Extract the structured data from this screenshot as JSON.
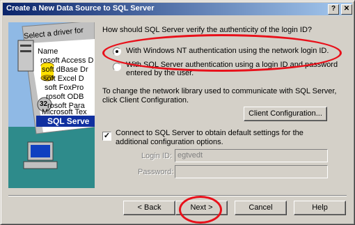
{
  "window": {
    "title": "Create a New Data Source to SQL Server",
    "help_glyph": "?",
    "close_glyph": "✕"
  },
  "art": {
    "header": "Select a driver for",
    "items": [
      "Name",
      "rosoft Access D",
      "soft dBase Dr",
      "soft Excel D",
      "soft FoxPro",
      "rosoft ODB",
      "rosoft Para",
      "Microsoft Tex",
      "SQL Serve"
    ],
    "badge": "32"
  },
  "auth": {
    "question": "How should SQL Server verify the authenticity of the login ID?",
    "option_nt": "With Windows NT authentication using the network login ID.",
    "option_sql_line1": "With SQL Server authentication using a login ID and password",
    "option_sql_line2": "entered by the user."
  },
  "network": {
    "text_line1": "To change the network library used to communicate with SQL Server,",
    "text_line2": "click Client Configuration.",
    "button": "Client Configuration..."
  },
  "connect": {
    "label_line1": "Connect to SQL Server to obtain default settings for the",
    "label_line2": "additional configuration options.",
    "checked_glyph": "✓"
  },
  "login": {
    "login_label": "Login ID:",
    "login_value": "egtvedt",
    "password_label": "Password:",
    "password_value": ""
  },
  "buttons": {
    "back": "< Back",
    "next": "Next >",
    "cancel": "Cancel",
    "help": "Help"
  },
  "colors": {
    "highlight_ring": "#e8101a",
    "titlebar_start": "#0a246a"
  }
}
